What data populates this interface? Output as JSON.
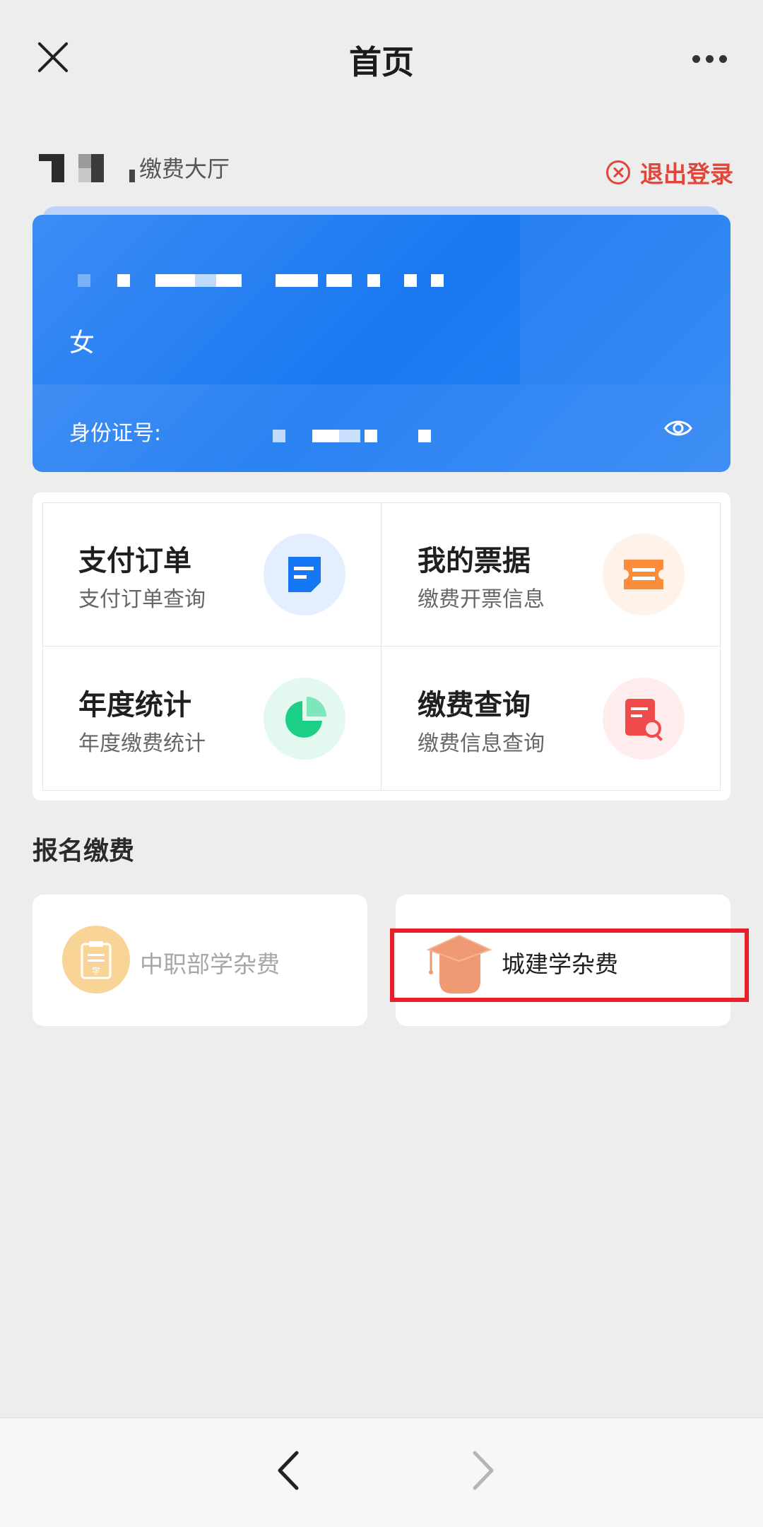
{
  "nav": {
    "title": "首页"
  },
  "header": {
    "hall_title": "缴费大厅",
    "logout_label": "退出登录"
  },
  "profile": {
    "gender": "女",
    "id_label": "身份证号:"
  },
  "functions": [
    {
      "title": "支付订单",
      "subtitle": "支付订单查询",
      "icon": "order-icon",
      "icon_bg": "#e3efff",
      "icon_color": "#1677f5"
    },
    {
      "title": "我的票据",
      "subtitle": "缴费开票信息",
      "icon": "ticket-icon",
      "icon_bg": "#fff2e8",
      "icon_color": "#fa8c3a"
    },
    {
      "title": "年度统计",
      "subtitle": "年度缴费统计",
      "icon": "pie-chart-icon",
      "icon_bg": "#e3f8ee",
      "icon_color": "#1ccf86"
    },
    {
      "title": "缴费查询",
      "subtitle": "缴费信息查询",
      "icon": "search-document-icon",
      "icon_bg": "#ffecec",
      "icon_color": "#f04b4b"
    }
  ],
  "section": {
    "title": "报名缴费"
  },
  "fees": [
    {
      "label": "中职部学杂费",
      "icon": "clipboard-icon",
      "icon_char": "学",
      "color": "#f5c77a"
    },
    {
      "label": "城建学杂费",
      "icon": "graduation-cap-icon",
      "color": "#ef9a72"
    }
  ],
  "colors": {
    "accent_blue": "#1978f0",
    "logout_red": "#e0463a",
    "highlight_red": "#e8202a"
  }
}
